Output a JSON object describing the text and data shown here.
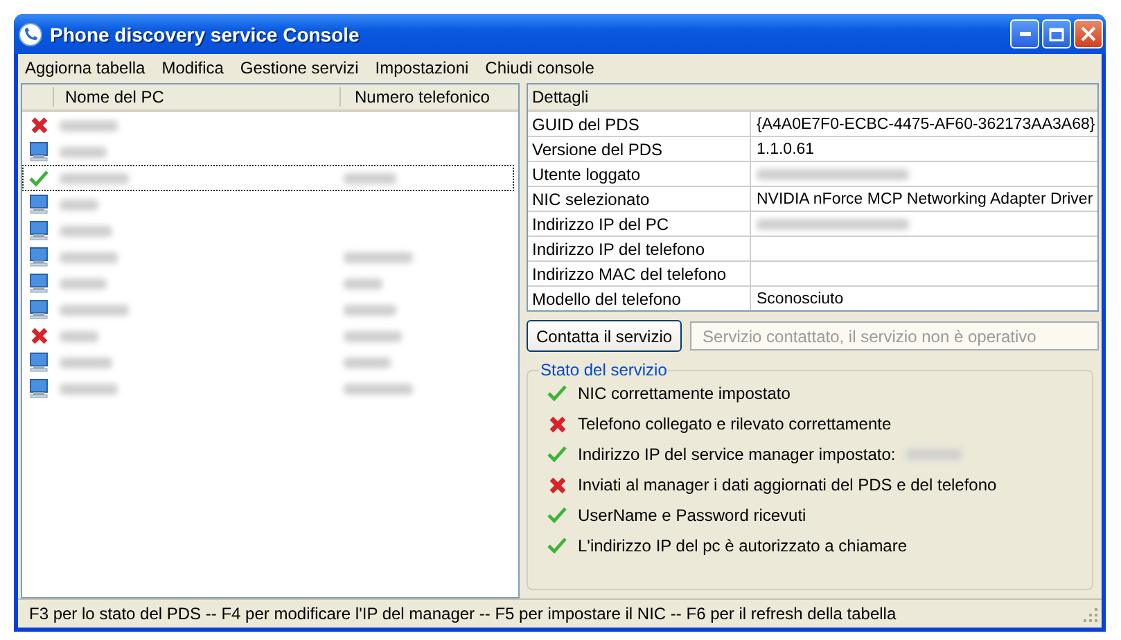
{
  "window": {
    "title": "Phone discovery service Console"
  },
  "menu": [
    "Aggiorna tabella",
    "Modifica",
    "Gestione servizi",
    "Impostazioni",
    "Chiudi console"
  ],
  "pc_table": {
    "columns": [
      "Nome del PC",
      "Numero telefonico"
    ],
    "rows": [
      {
        "kind": "error",
        "name_redacted": true,
        "phone_redacted": false,
        "selected": false
      },
      {
        "kind": "pc",
        "name_redacted": true,
        "phone_redacted": false,
        "selected": false
      },
      {
        "kind": "ok",
        "name_redacted": true,
        "phone_redacted": true,
        "selected": true
      },
      {
        "kind": "pc",
        "name_redacted": true,
        "phone_redacted": false,
        "selected": false
      },
      {
        "kind": "pc",
        "name_redacted": true,
        "phone_redacted": false,
        "selected": false
      },
      {
        "kind": "pc",
        "name_redacted": true,
        "phone_redacted": true,
        "selected": false
      },
      {
        "kind": "pc",
        "name_redacted": true,
        "phone_redacted": true,
        "selected": false
      },
      {
        "kind": "pc",
        "name_redacted": true,
        "phone_redacted": true,
        "selected": false
      },
      {
        "kind": "error",
        "name_redacted": true,
        "phone_redacted": true,
        "selected": false
      },
      {
        "kind": "pc",
        "name_redacted": true,
        "phone_redacted": true,
        "selected": false
      },
      {
        "kind": "pc",
        "name_redacted": true,
        "phone_redacted": true,
        "selected": false
      }
    ]
  },
  "details": {
    "header": "Dettagli",
    "rows": [
      {
        "label": "GUID del PDS",
        "value": "{A4A0E7F0-ECBC-4475-AF60-362173AA3A68}"
      },
      {
        "label": "Versione del PDS",
        "value": "1.1.0.61"
      },
      {
        "label": "Utente loggato",
        "redacted": true
      },
      {
        "label": "NIC selezionato",
        "value": "NVIDIA nForce MCP Networking Adapter Driver"
      },
      {
        "label": "Indirizzo IP del PC",
        "redacted": true
      },
      {
        "label": "Indirizzo IP del telefono"
      },
      {
        "label": "Indirizzo MAC del telefono"
      },
      {
        "label": "Modello del telefono",
        "value": "Sconosciuto"
      }
    ]
  },
  "contact_button": "Contatta il servizio",
  "contact_result": {
    "value": "Servizio contattato, il servizio non è operativo"
  },
  "service_status": {
    "title": "Stato del servizio",
    "items": [
      {
        "kind": "ok",
        "text": "NIC correttamente impostato"
      },
      {
        "kind": "fail",
        "text": "Telefono collegato e rilevato correttamente"
      },
      {
        "kind": "ok",
        "text": "Indirizzo IP del service manager impostato:",
        "redacted_value": true
      },
      {
        "kind": "fail",
        "text": "Inviati al manager i dati aggiornati del PDS e del telefono"
      },
      {
        "kind": "ok",
        "text": "UserName e Password ricevuti"
      },
      {
        "kind": "ok",
        "text": "L'indirizzo IP del pc è autorizzato a chiamare"
      }
    ]
  },
  "status_bar": "F3 per lo stato del PDS -- F4 per modificare l'IP del manager -- F5 per impostare il NIC -- F6 per il refresh della tabella"
}
